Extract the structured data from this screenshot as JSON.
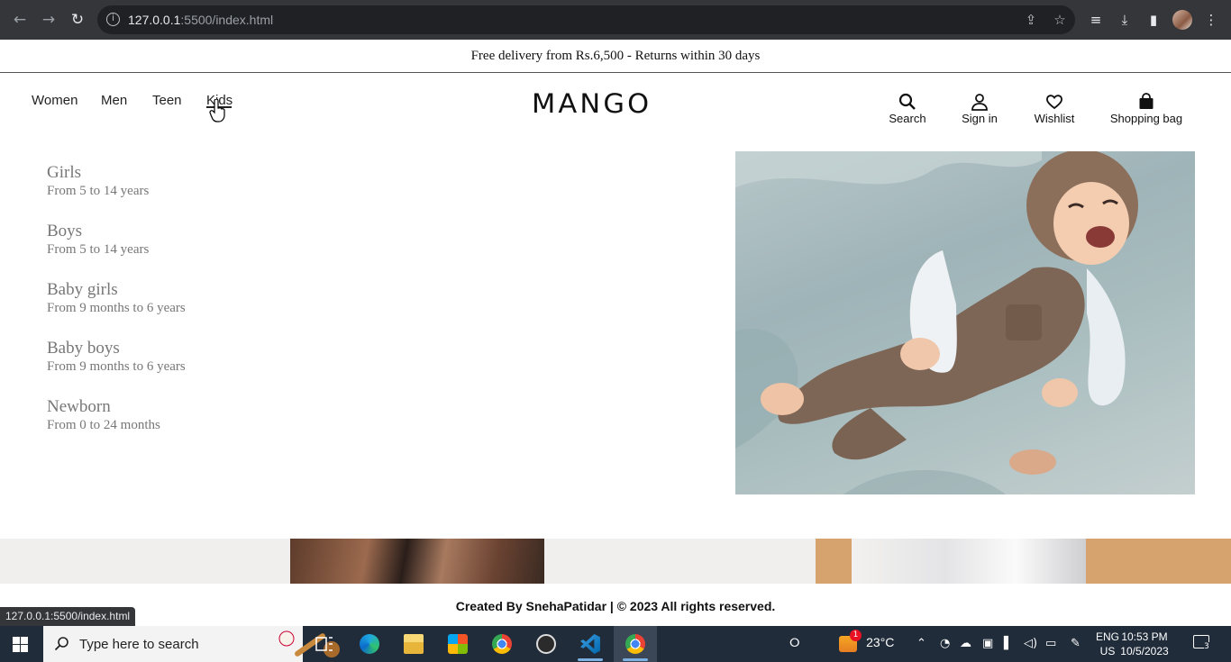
{
  "browser": {
    "url_host": "127.0.0.1",
    "url_rest": ":5500/index.html",
    "status_url": "127.0.0.1:5500/index.html"
  },
  "promo": {
    "text": "Free delivery from Rs.6,500 - Returns within 30 days"
  },
  "header": {
    "menu": [
      {
        "label": "Women"
      },
      {
        "label": "Men"
      },
      {
        "label": "Teen"
      },
      {
        "label": "Kids"
      }
    ],
    "logo": "MANGO",
    "actions": [
      {
        "label": "Search",
        "icon": "search-icon"
      },
      {
        "label": "Sign in",
        "icon": "user-icon"
      },
      {
        "label": "Wishlist",
        "icon": "heart-icon"
      },
      {
        "label": "Shopping bag",
        "icon": "bag-icon"
      }
    ]
  },
  "kids_menu": [
    {
      "name": "Girls",
      "range": "From 5 to 14 years"
    },
    {
      "name": "Boys",
      "range": "From 5 to 14 years"
    },
    {
      "name": "Baby girls",
      "range": "From 9 months to 6 years"
    },
    {
      "name": "Baby boys",
      "range": "From 9 months to 6 years"
    },
    {
      "name": "Newborn",
      "range": "From 0 to 24 months"
    }
  ],
  "footer": {
    "text": "Created By SnehaPatidar | © 2023 All rights reserved."
  },
  "taskbar": {
    "search_placeholder": "Type here to search",
    "weather": "23°C",
    "weather_badge": "1",
    "lang_top": "ENG",
    "lang_bottom": "US",
    "time": "10:53 PM",
    "date": "10/5/2023",
    "notifications": "3"
  },
  "colors": {
    "chrome_bg": "#35363a",
    "omnibox_bg": "#202124",
    "taskbar_bg": "#202c3a",
    "category_text": "#777777"
  }
}
